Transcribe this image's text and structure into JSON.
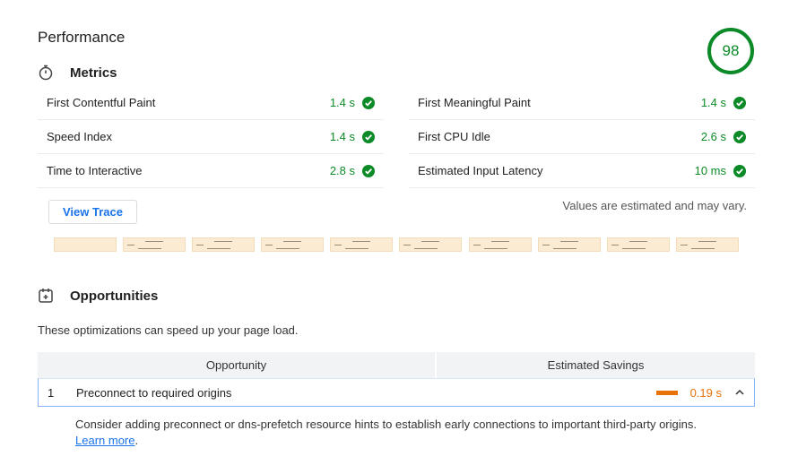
{
  "performance": {
    "title": "Performance",
    "score": "98"
  },
  "metrics": {
    "heading": "Metrics",
    "left": [
      {
        "label": "First Contentful Paint",
        "value": "1.4 s"
      },
      {
        "label": "Speed Index",
        "value": "1.4 s"
      },
      {
        "label": "Time to Interactive",
        "value": "2.8 s"
      }
    ],
    "right": [
      {
        "label": "First Meaningful Paint",
        "value": "1.4 s"
      },
      {
        "label": "First CPU Idle",
        "value": "2.6 s"
      },
      {
        "label": "Estimated Input Latency",
        "value": "10 ms"
      }
    ],
    "view_trace_label": "View Trace",
    "estimate_note": "Values are estimated and may vary."
  },
  "opportunities": {
    "heading": "Opportunities",
    "description": "These optimizations can speed up your page load.",
    "col_opportunity": "Opportunity",
    "col_savings": "Estimated Savings",
    "items": [
      {
        "num": "1",
        "title": "Preconnect to required origins",
        "savings": "0.19 s",
        "detail_text": "Consider adding preconnect or dns-prefetch resource hints to establish early connections to important third-party origins. ",
        "link_text": "Learn more",
        "detail_end": "."
      }
    ]
  },
  "colors": {
    "pass": "#0c8a27",
    "average": "#e8710a",
    "link": "#1a73e8"
  }
}
